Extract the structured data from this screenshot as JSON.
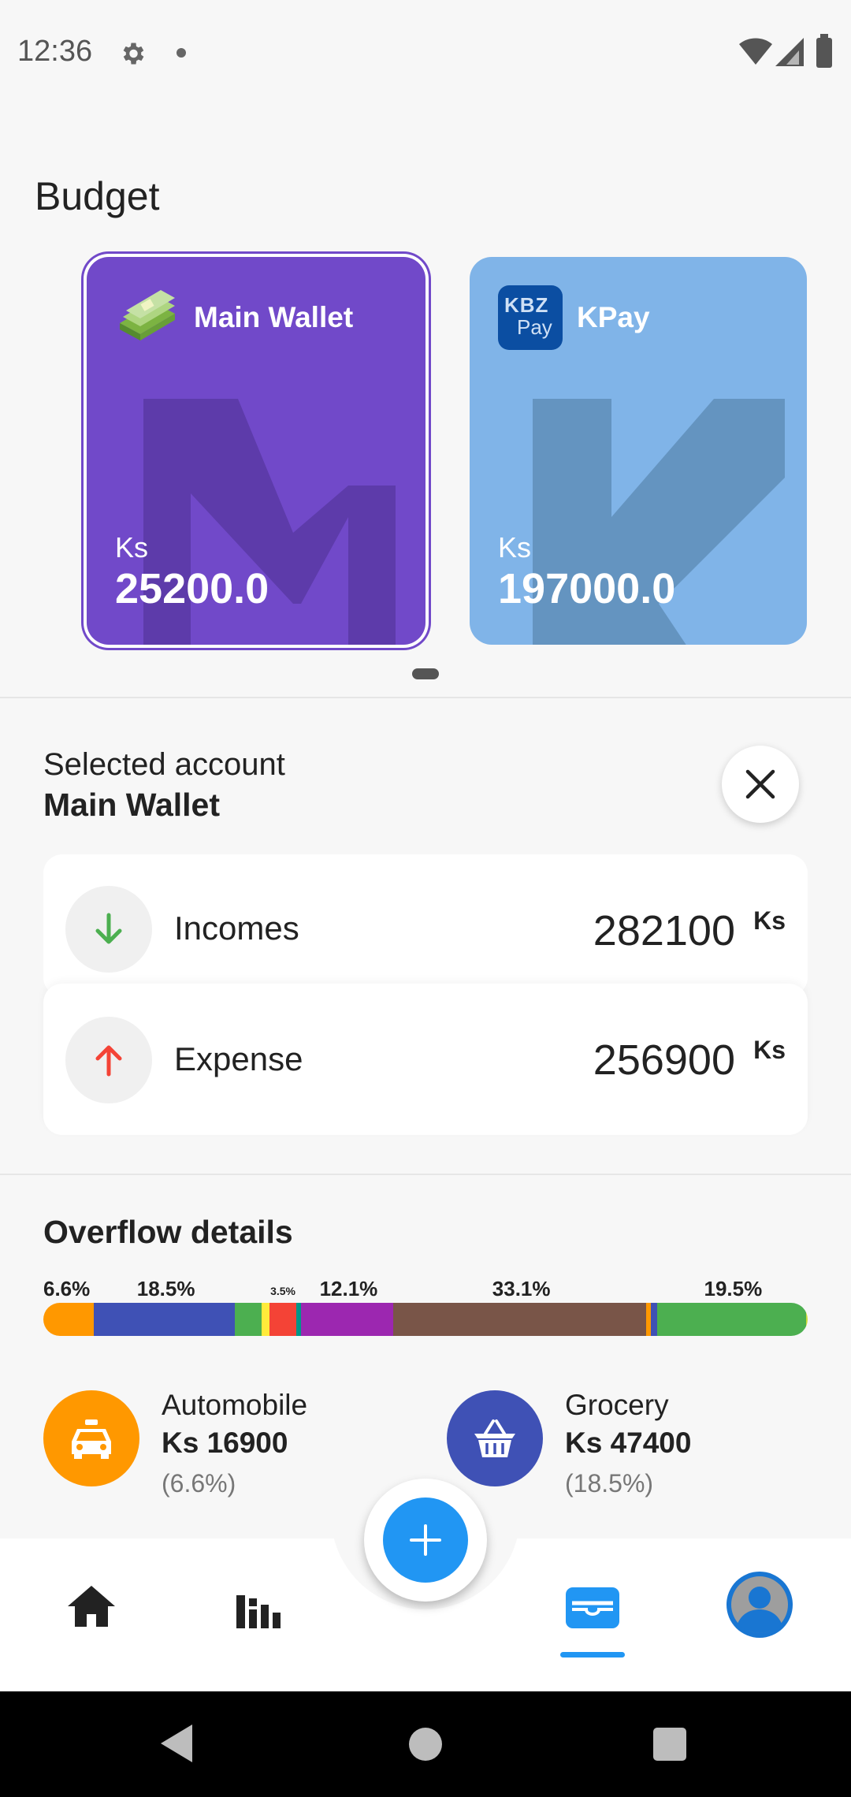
{
  "status": {
    "time": "12:36"
  },
  "page": {
    "title": "Budget"
  },
  "wallets": [
    {
      "name": "Main Wallet",
      "currency": "Ks",
      "balance": "25200.0",
      "color": "#7149c9",
      "letter": "M",
      "selected": true
    },
    {
      "name": "KPay",
      "currency": "Ks",
      "balance": "197000.0",
      "color": "#80b4e8",
      "letter": "K",
      "icon_text_top": "KBZ",
      "icon_text_bottom": "Pay",
      "selected": false
    }
  ],
  "selected_account": {
    "label": "Selected account",
    "value": "Main Wallet"
  },
  "summary": {
    "income": {
      "label": "Incomes",
      "amount": "282100",
      "unit": "Ks",
      "color": "#4caf50"
    },
    "expense": {
      "label": "Expense",
      "amount": "256900",
      "unit": "Ks",
      "color": "#f44336"
    }
  },
  "overflow": {
    "title": "Overflow details",
    "segments": [
      {
        "pct": 6.6,
        "color": "#ff9800",
        "label": "6.6%"
      },
      {
        "pct": 18.5,
        "color": "#3f51b5",
        "label": "18.5%"
      },
      {
        "pct": 3.5,
        "color": "#4caf50",
        "label": ""
      },
      {
        "pct": 1.0,
        "color": "#ffeb3b",
        "label": ""
      },
      {
        "pct": 3.5,
        "color": "#f44336",
        "label": "3.5%"
      },
      {
        "pct": 0.6,
        "color": "#009688",
        "label": ""
      },
      {
        "pct": 12.1,
        "color": "#9c27b0",
        "label": "12.1%"
      },
      {
        "pct": 33.1,
        "color": "#795548",
        "label": "33.1%"
      },
      {
        "pct": 0.6,
        "color": "#ff9800",
        "label": ""
      },
      {
        "pct": 0.8,
        "color": "#3f51b5",
        "label": ""
      },
      {
        "pct": 19.5,
        "color": "#4caf50",
        "label": "19.5%"
      },
      {
        "pct": 0.2,
        "color": "#cddc39",
        "label": ""
      }
    ],
    "categories": [
      {
        "name": "Automobile",
        "amount": "Ks 16900",
        "pct": "(6.6%)",
        "color": "#ff9800",
        "icon": "taxi-icon"
      },
      {
        "name": "Grocery",
        "amount": "Ks 47400",
        "pct": "(18.5%)",
        "color": "#3f51b5",
        "icon": "basket-icon"
      }
    ]
  },
  "nav": {
    "items": [
      "home-icon",
      "stats-icon",
      "add-icon",
      "wallet-icon",
      "profile-icon"
    ],
    "active": "wallet-icon",
    "accent": "#2196f3"
  }
}
